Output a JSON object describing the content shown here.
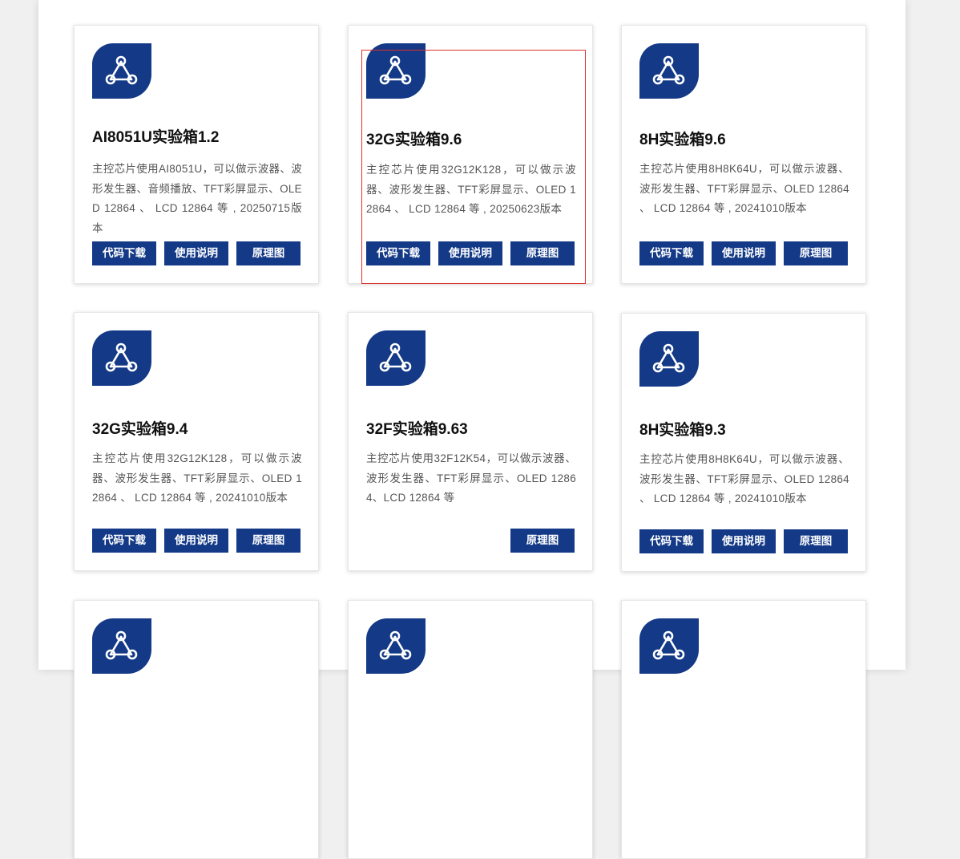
{
  "colors": {
    "brand": "#133987",
    "highlight": "#e0302c"
  },
  "logo_icon": "network-triangle-icon",
  "cards": [
    {
      "title": "AI8051U实验箱1.2",
      "desc": "主控芯片使用AI8051U，可以做示波器、波形发生器、音频播放、TFT彩屏显示、OLED 12864 、 LCD 12864 等 , 20250715版本",
      "buttons": [
        "代码下载",
        "使用说明",
        "原理图"
      ]
    },
    {
      "title": "32G实验箱9.6",
      "desc": "主控芯片使用32G12K128，可以做示波器、波形发生器、TFT彩屏显示、OLED 12864 、 LCD 12864 等 , 20250623版本",
      "buttons": [
        "代码下载",
        "使用说明",
        "原理图"
      ]
    },
    {
      "title": "8H实验箱9.6",
      "desc": "主控芯片使用8H8K64U，可以做示波器、波形发生器、TFT彩屏显示、OLED 12864 、 LCD 12864 等 , 20241010版本",
      "buttons": [
        "代码下载",
        "使用说明",
        "原理图"
      ]
    },
    {
      "title": "32G实验箱9.4",
      "desc": "主控芯片使用32G12K128，可以做示波器、波形发生器、TFT彩屏显示、OLED 12864 、 LCD 12864 等 , 20241010版本",
      "buttons": [
        "代码下载",
        "使用说明",
        "原理图"
      ]
    },
    {
      "title": "32F实验箱9.63",
      "desc": "主控芯片使用32F12K54，可以做示波器、波形发生器、TFT彩屏显示、OLED 12864、LCD 12864 等",
      "buttons": [
        "原理图"
      ]
    },
    {
      "title": "8H实验箱9.3",
      "desc": "主控芯片使用8H8K64U，可以做示波器、波形发生器、TFT彩屏显示、OLED 12864 、 LCD 12864 等 , 20241010版本",
      "buttons": [
        "代码下载",
        "使用说明",
        "原理图"
      ]
    },
    {
      "title": "",
      "desc": "",
      "buttons": []
    },
    {
      "title": "",
      "desc": "",
      "buttons": []
    },
    {
      "title": "",
      "desc": "",
      "buttons": []
    }
  ]
}
